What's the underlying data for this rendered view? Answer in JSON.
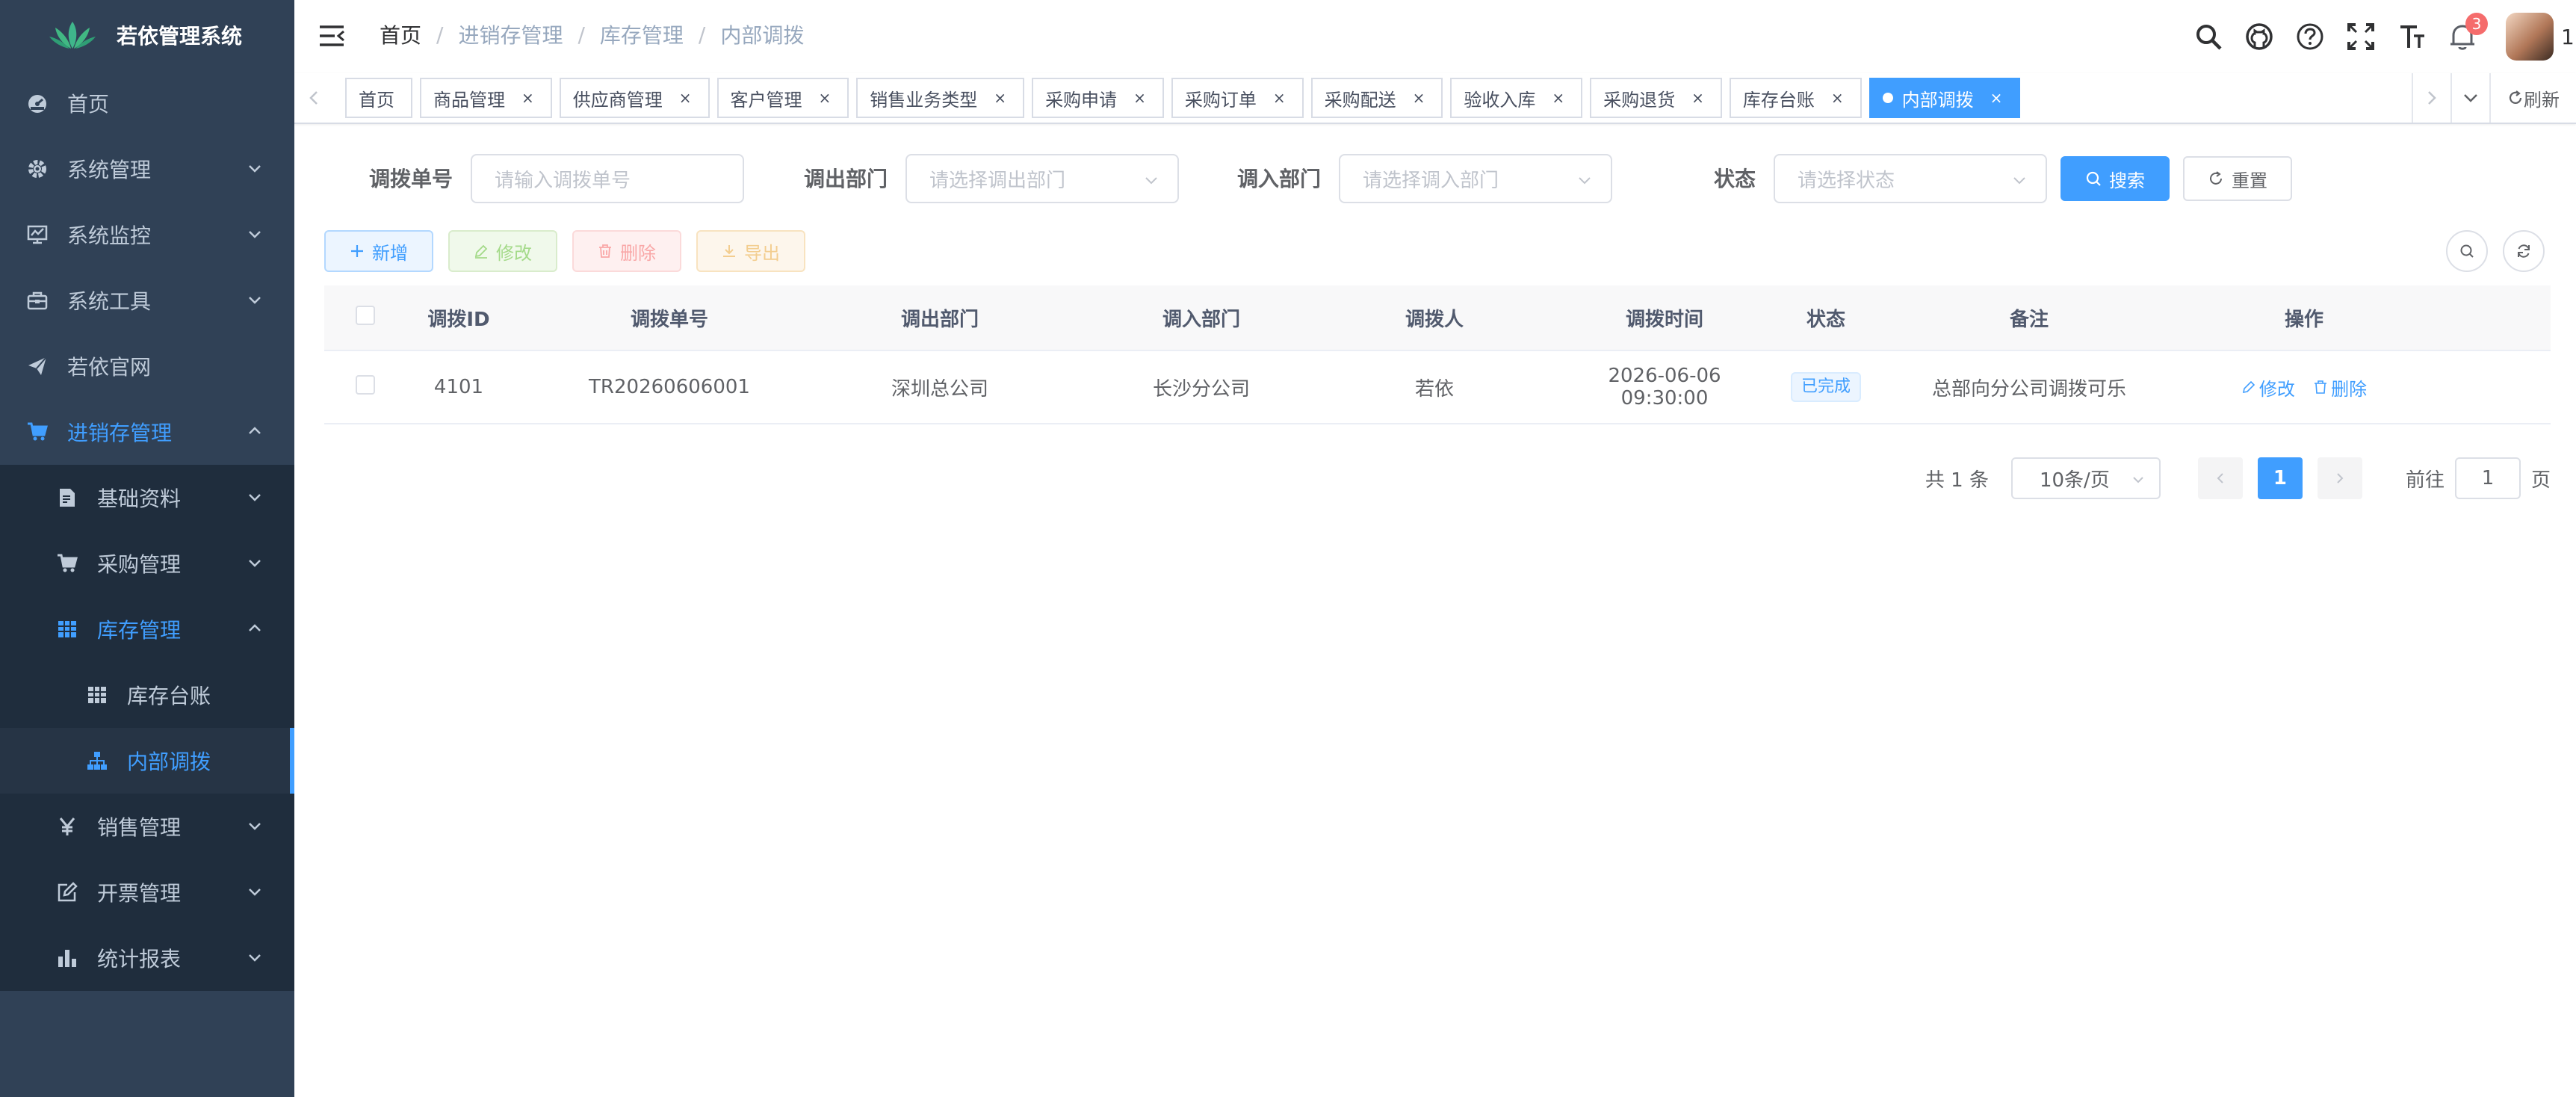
{
  "app": {
    "title": "若依管理系统"
  },
  "sidebar": {
    "items": [
      {
        "label": "首页",
        "icon": "dashboard-icon"
      },
      {
        "label": "系统管理",
        "icon": "gear-icon"
      },
      {
        "label": "系统监控",
        "icon": "monitor-icon"
      },
      {
        "label": "系统工具",
        "icon": "toolbox-icon"
      },
      {
        "label": "若依官网",
        "icon": "send-icon"
      },
      {
        "label": "进销存管理",
        "icon": "cart-icon"
      },
      {
        "label": "基础资料",
        "icon": "document-icon"
      },
      {
        "label": "采购管理",
        "icon": "cart-icon"
      },
      {
        "label": "库存管理",
        "icon": "grid-icon"
      },
      {
        "label": "库存台账",
        "icon": "grid-icon"
      },
      {
        "label": "内部调拨",
        "icon": "tree-icon"
      },
      {
        "label": "销售管理",
        "icon": "yen-icon"
      },
      {
        "label": "开票管理",
        "icon": "edit-icon"
      },
      {
        "label": "统计报表",
        "icon": "bar-chart-icon"
      }
    ]
  },
  "breadcrumb": [
    "首页",
    "进销存管理",
    "库存管理",
    "内部调拨"
  ],
  "navbar": {
    "badge_count": "3",
    "user_label": "1"
  },
  "tags": [
    "首页",
    "商品管理",
    "供应商管理",
    "客户管理",
    "销售业务类型",
    "采购申请",
    "采购订单",
    "采购配送",
    "验收入库",
    "采购退货",
    "库存台账",
    "内部调拨"
  ],
  "tag_tools": {
    "refresh_label": "刷新"
  },
  "search": {
    "fields": [
      {
        "label": "调拨单号",
        "placeholder": "请输入调拨单号"
      },
      {
        "label": "调出部门",
        "placeholder": "请选择调出部门"
      },
      {
        "label": "调入部门",
        "placeholder": "请选择调入部门"
      },
      {
        "label": "状态",
        "placeholder": "请选择状态"
      }
    ],
    "search_label": "搜索",
    "reset_label": "重置"
  },
  "toolbar": {
    "add_label": "新增",
    "edit_label": "修改",
    "delete_label": "删除",
    "export_label": "导出"
  },
  "table": {
    "columns": [
      "调拨ID",
      "调拨单号",
      "调出部门",
      "调入部门",
      "调拨人",
      "调拨时间",
      "状态",
      "备注",
      "操作"
    ],
    "rows": [
      {
        "id": "4101",
        "no": "TR20260606001",
        "from": "深圳总公司",
        "to": "长沙分公司",
        "person": "若依",
        "time": "2026-06-06 09:30:00",
        "status": "已完成",
        "remark": "总部向分公司调拨可乐",
        "edit": "修改",
        "delete": "删除"
      }
    ]
  },
  "pagination": {
    "total_text": "共 1 条",
    "page_size": "10条/页",
    "current_page": "1",
    "goto_label": "前往",
    "goto_value": "1",
    "page_unit": "页"
  },
  "colors": {
    "primary": "#409eff",
    "sidebar_bg": "#304156",
    "submenu_bg": "#1f2d3d",
    "badge": "#f56c6c"
  }
}
